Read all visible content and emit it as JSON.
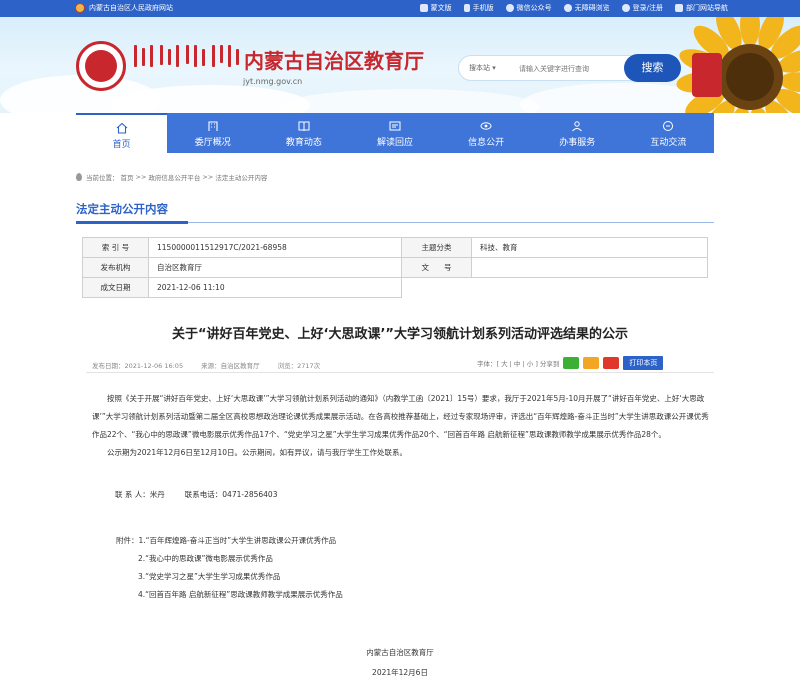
{
  "topbar": {
    "gov_site": "内蒙古自治区人民政府网站",
    "links": [
      "蒙文版",
      "手机版",
      "微信公众号",
      "无障碍浏览",
      "登录/注册",
      "部门网站导航"
    ]
  },
  "header": {
    "site_title": "内蒙古自治区教育厅",
    "site_url": "jyt.nmg.gov.cn",
    "search_scope": "搜本站",
    "search_scope_arrow": "▾",
    "search_placeholder": "请输入关键字进行查询",
    "search_button": "搜索"
  },
  "nav": {
    "items": [
      {
        "label": "首页",
        "icon": "home-icon"
      },
      {
        "label": "委厅概况",
        "icon": "building-icon"
      },
      {
        "label": "教育动态",
        "icon": "book-icon"
      },
      {
        "label": "解读回应",
        "icon": "message-icon"
      },
      {
        "label": "信息公开",
        "icon": "eye-icon"
      },
      {
        "label": "办事服务",
        "icon": "service-icon"
      },
      {
        "label": "互动交流",
        "icon": "chat-icon"
      }
    ]
  },
  "breadcrumb": {
    "prefix": "当前位置：",
    "home": "首页",
    "sep": ">>",
    "level1": "政府信息公开平台",
    "level2": "法定主动公开内容"
  },
  "section": {
    "title": "法定主动公开内容"
  },
  "info": {
    "index_label": "索 引 号",
    "index_value": "1150000011512917C/2021-68958",
    "topic_label": "主题分类",
    "topic_value": "科技、教育",
    "org_label": "发布机构",
    "org_value": "自治区教育厅",
    "doc_label": "文　　号",
    "doc_value": "",
    "date_label": "成文日期",
    "date_value": "2021-12-06 11:10"
  },
  "article": {
    "title": "关于“讲好百年党史、上好‘大思政课’”大学习领航计划系列活动评选结果的公示",
    "publish_time": "发布日期：2021-12-06 16:05",
    "source": "来源：自治区教育厅",
    "views": "浏览：2717次",
    "font_size": "字体：[ 大 | 中 | 小 ] 分享到",
    "print_label": "打印本页",
    "paragraph1": "按照《关于开展“讲好百年党史、上好‘大思政课’”大学习领航计划系列活动的通知》（内教学工函〔2021〕15号）要求，我厅于2021年5月-10月开展了“讲好百年党史、上好‘大思政课’”大学习领航计划系列活动暨第二届全区高校思想政治理论课优秀成果展示活动。在各高校推荐基础上，经过专家现场评审，评选出“百年辉煌路-奋斗正当时”大学生讲思政课公开课优秀作品22个、“我心中的思政课”微电影展示优秀作品17个、“党史学习之星”大学生学习成果优秀作品20个、“回首百年路 启航新征程”思政课教师教学成果展示优秀作品28个。",
    "paragraph2": "公示期为2021年12月6日至12月10日。公示期间，如有异议，请与我厅学生工作处联系。",
    "contact_person": "联 系 人：米丹",
    "contact_phone": "联系电话：0471-2856403",
    "attachments": [
      "附件：1.“百年辉煌路-奋斗正当时”大学生讲思政课公开课优秀作品",
      "2.“我心中的思政课”微电影展示优秀作品",
      "3.“党史学习之星”大学生学习成果优秀作品",
      "4.“回首百年路 启航新征程”思政课教师教学成果展示优秀作品"
    ],
    "signature": "内蒙古自治区教育厅",
    "sign_date": "2021年12月6日"
  },
  "colors": {
    "brand_blue": "#2d63c8",
    "brand_red": "#c8272d",
    "nav_blue": "#3f74d8"
  }
}
